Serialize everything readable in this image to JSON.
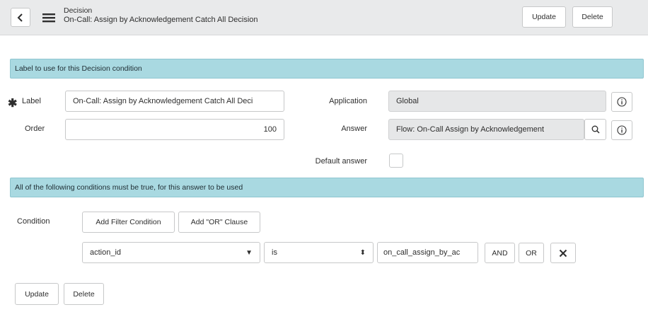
{
  "header": {
    "title": "Decision",
    "subtitle": "On-Call: Assign by Acknowledgement Catch All Decision",
    "update_label": "Update",
    "delete_label": "Delete"
  },
  "sections": {
    "label_section": "Label to use for this Decision condition",
    "conditions_section": "All of the following conditions must be true, for this answer to be used"
  },
  "form": {
    "label_label": "Label",
    "label_value": "On-Call: Assign by Acknowledgement Catch All Deci",
    "order_label": "Order",
    "order_value": "100",
    "application_label": "Application",
    "application_value": "Global",
    "answer_label": "Answer",
    "answer_value": "Flow: On-Call Assign by Acknowledgement",
    "default_answer_label": "Default answer"
  },
  "condition": {
    "label": "Condition",
    "add_filter_label": "Add Filter Condition",
    "add_or_label": "Add \"OR\" Clause",
    "field_value": "action_id",
    "operator_value": "is",
    "value_value": "on_call_assign_by_ac",
    "and_label": "AND",
    "or_label": "OR"
  },
  "footer": {
    "update_label": "Update",
    "delete_label": "Delete"
  },
  "icons": [
    "chevron-left-icon",
    "hamburger-menu-icon",
    "info-icon",
    "search-icon",
    "close-icon",
    "required-asterisk-icon",
    "select-arrow-icon"
  ]
}
